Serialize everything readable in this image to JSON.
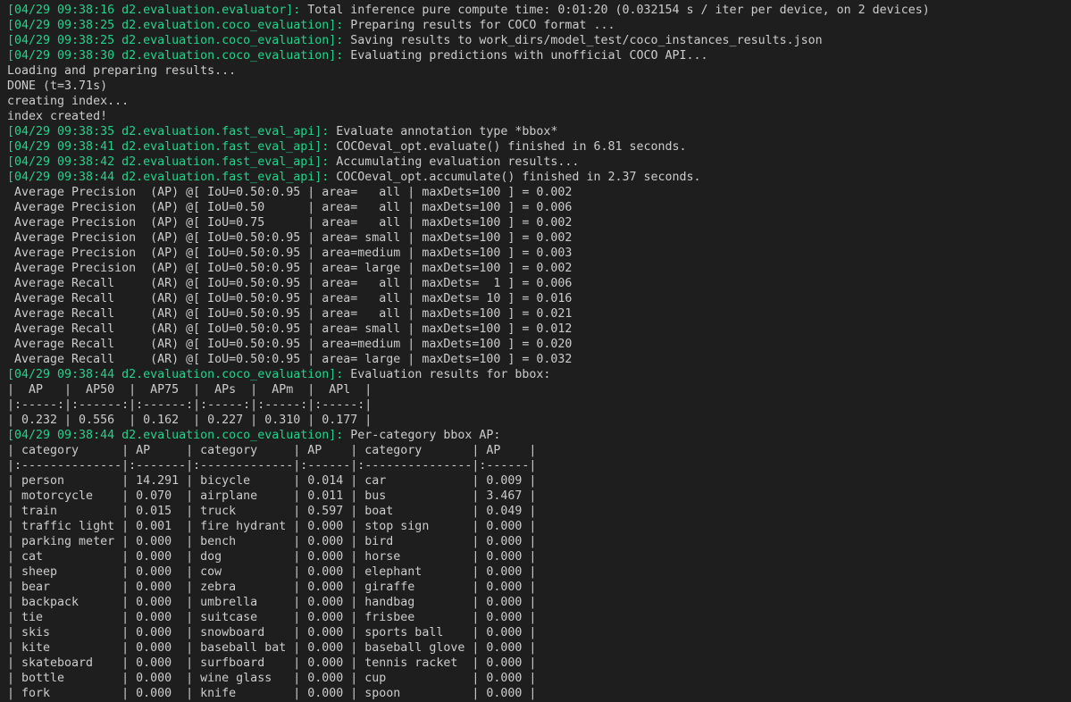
{
  "colors": {
    "background": "#1e1e1e",
    "text": "#cccccc",
    "log_prefix": "#23d18b"
  },
  "lines": [
    {
      "prefix": "[04/29 09:38:16 d2.evaluation.evaluator]:",
      "text": " Total inference pure compute time: 0:01:20 (0.032154 s / iter per device, on 2 devices)"
    },
    {
      "prefix": "[04/29 09:38:25 d2.evaluation.coco_evaluation]:",
      "text": " Preparing results for COCO format ..."
    },
    {
      "prefix": "[04/29 09:38:25 d2.evaluation.coco_evaluation]:",
      "text": " Saving results to work_dirs/model_test/coco_instances_results.json"
    },
    {
      "prefix": "[04/29 09:38:30 d2.evaluation.coco_evaluation]:",
      "text": " Evaluating predictions with unofficial COCO API..."
    },
    {
      "prefix": "",
      "text": "Loading and preparing results..."
    },
    {
      "prefix": "",
      "text": "DONE (t=3.71s)"
    },
    {
      "prefix": "",
      "text": "creating index..."
    },
    {
      "prefix": "",
      "text": "index created!"
    },
    {
      "prefix": "[04/29 09:38:35 d2.evaluation.fast_eval_api]:",
      "text": " Evaluate annotation type *bbox*"
    },
    {
      "prefix": "[04/29 09:38:41 d2.evaluation.fast_eval_api]:",
      "text": " COCOeval_opt.evaluate() finished in 6.81 seconds."
    },
    {
      "prefix": "[04/29 09:38:42 d2.evaluation.fast_eval_api]:",
      "text": " Accumulating evaluation results..."
    },
    {
      "prefix": "[04/29 09:38:44 d2.evaluation.fast_eval_api]:",
      "text": " COCOeval_opt.accumulate() finished in 2.37 seconds."
    },
    {
      "prefix": "",
      "text": " Average Precision  (AP) @[ IoU=0.50:0.95 | area=   all | maxDets=100 ] = 0.002"
    },
    {
      "prefix": "",
      "text": " Average Precision  (AP) @[ IoU=0.50      | area=   all | maxDets=100 ] = 0.006"
    },
    {
      "prefix": "",
      "text": " Average Precision  (AP) @[ IoU=0.75      | area=   all | maxDets=100 ] = 0.002"
    },
    {
      "prefix": "",
      "text": " Average Precision  (AP) @[ IoU=0.50:0.95 | area= small | maxDets=100 ] = 0.002"
    },
    {
      "prefix": "",
      "text": " Average Precision  (AP) @[ IoU=0.50:0.95 | area=medium | maxDets=100 ] = 0.003"
    },
    {
      "prefix": "",
      "text": " Average Precision  (AP) @[ IoU=0.50:0.95 | area= large | maxDets=100 ] = 0.002"
    },
    {
      "prefix": "",
      "text": " Average Recall     (AR) @[ IoU=0.50:0.95 | area=   all | maxDets=  1 ] = 0.006"
    },
    {
      "prefix": "",
      "text": " Average Recall     (AR) @[ IoU=0.50:0.95 | area=   all | maxDets= 10 ] = 0.016"
    },
    {
      "prefix": "",
      "text": " Average Recall     (AR) @[ IoU=0.50:0.95 | area=   all | maxDets=100 ] = 0.021"
    },
    {
      "prefix": "",
      "text": " Average Recall     (AR) @[ IoU=0.50:0.95 | area= small | maxDets=100 ] = 0.012"
    },
    {
      "prefix": "",
      "text": " Average Recall     (AR) @[ IoU=0.50:0.95 | area=medium | maxDets=100 ] = 0.020"
    },
    {
      "prefix": "",
      "text": " Average Recall     (AR) @[ IoU=0.50:0.95 | area= large | maxDets=100 ] = 0.032"
    },
    {
      "prefix": "[04/29 09:38:44 d2.evaluation.coco_evaluation]:",
      "text": " Evaluation results for bbox:"
    },
    {
      "prefix": "",
      "text": "|  AP   |  AP50  |  AP75  |  APs  |  APm  |  APl  |"
    },
    {
      "prefix": "",
      "text": "|:-----:|:------:|:------:|:-----:|:-----:|:-----:|"
    },
    {
      "prefix": "",
      "text": "| 0.232 | 0.556  | 0.162  | 0.227 | 0.310 | 0.177 |"
    },
    {
      "prefix": "[04/29 09:38:44 d2.evaluation.coco_evaluation]:",
      "text": " Per-category bbox AP:"
    },
    {
      "prefix": "",
      "text": "| category      | AP     | category     | AP    | category       | AP    |"
    },
    {
      "prefix": "",
      "text": "|:--------------|:-------|:-------------|:------|:---------------|:------|"
    },
    {
      "prefix": "",
      "text": "| person        | 14.291 | bicycle      | 0.014 | car            | 0.009 |"
    },
    {
      "prefix": "",
      "text": "| motorcycle    | 0.070  | airplane     | 0.011 | bus            | 3.467 |"
    },
    {
      "prefix": "",
      "text": "| train         | 0.015  | truck        | 0.597 | boat           | 0.049 |"
    },
    {
      "prefix": "",
      "text": "| traffic light | 0.001  | fire hydrant | 0.000 | stop sign      | 0.000 |"
    },
    {
      "prefix": "",
      "text": "| parking meter | 0.000  | bench        | 0.000 | bird           | 0.000 |"
    },
    {
      "prefix": "",
      "text": "| cat           | 0.000  | dog          | 0.000 | horse          | 0.000 |"
    },
    {
      "prefix": "",
      "text": "| sheep         | 0.000  | cow          | 0.000 | elephant       | 0.000 |"
    },
    {
      "prefix": "",
      "text": "| bear          | 0.000  | zebra        | 0.000 | giraffe        | 0.000 |"
    },
    {
      "prefix": "",
      "text": "| backpack      | 0.000  | umbrella     | 0.000 | handbag        | 0.000 |"
    },
    {
      "prefix": "",
      "text": "| tie           | 0.000  | suitcase     | 0.000 | frisbee        | 0.000 |"
    },
    {
      "prefix": "",
      "text": "| skis          | 0.000  | snowboard    | 0.000 | sports ball    | 0.000 |"
    },
    {
      "prefix": "",
      "text": "| kite          | 0.000  | baseball bat | 0.000 | baseball glove | 0.000 |"
    },
    {
      "prefix": "",
      "text": "| skateboard    | 0.000  | surfboard    | 0.000 | tennis racket  | 0.000 |"
    },
    {
      "prefix": "",
      "text": "| bottle        | 0.000  | wine glass   | 0.000 | cup            | 0.000 |"
    },
    {
      "prefix": "",
      "text": "| fork          | 0.000  | knife        | 0.000 | spoon          | 0.000 |"
    }
  ]
}
